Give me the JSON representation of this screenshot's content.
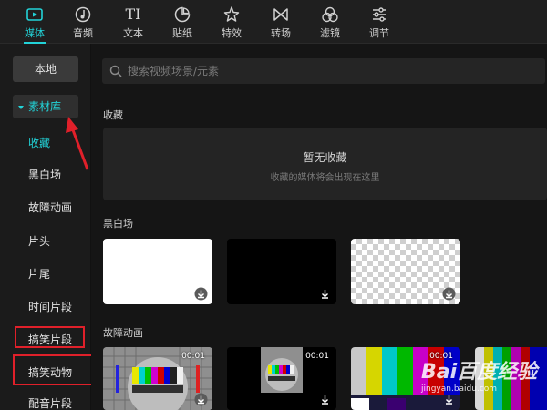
{
  "toolbar": {
    "tabs": [
      {
        "label": "媒体",
        "icon": "media-icon",
        "active": true
      },
      {
        "label": "音频",
        "icon": "audio-icon"
      },
      {
        "label": "文本",
        "icon": "text-icon"
      },
      {
        "label": "贴纸",
        "icon": "sticker-icon"
      },
      {
        "label": "特效",
        "icon": "effects-icon"
      },
      {
        "label": "转场",
        "icon": "transition-icon"
      },
      {
        "label": "滤镜",
        "icon": "filter-icon"
      },
      {
        "label": "调节",
        "icon": "adjust-icon"
      }
    ],
    "text_icon_glyph": "TI"
  },
  "sidebar": {
    "local_label": "本地",
    "library_label": "素材库",
    "items": [
      "收藏",
      "黑白场",
      "故障动画",
      "片头",
      "片尾",
      "时间片段",
      "搞笑片段",
      "搞笑动物",
      "配音片段"
    ]
  },
  "main": {
    "search_placeholder": "搜索视频场景/元素",
    "favorites": {
      "title": "收藏",
      "empty_title": "暂无收藏",
      "empty_sub": "收藏的媒体将会出现在这里"
    },
    "bw_section": {
      "title": "黑白场"
    },
    "glitch_section": {
      "title": "故障动画",
      "durations": [
        "00:01",
        "00:01",
        "00:01"
      ]
    }
  },
  "watermark": {
    "brand": "Bai百度经验",
    "url": "jingyan.baidu.com"
  },
  "colors": {
    "accent": "#22d3d8",
    "annotation_red": "#e0202a"
  }
}
